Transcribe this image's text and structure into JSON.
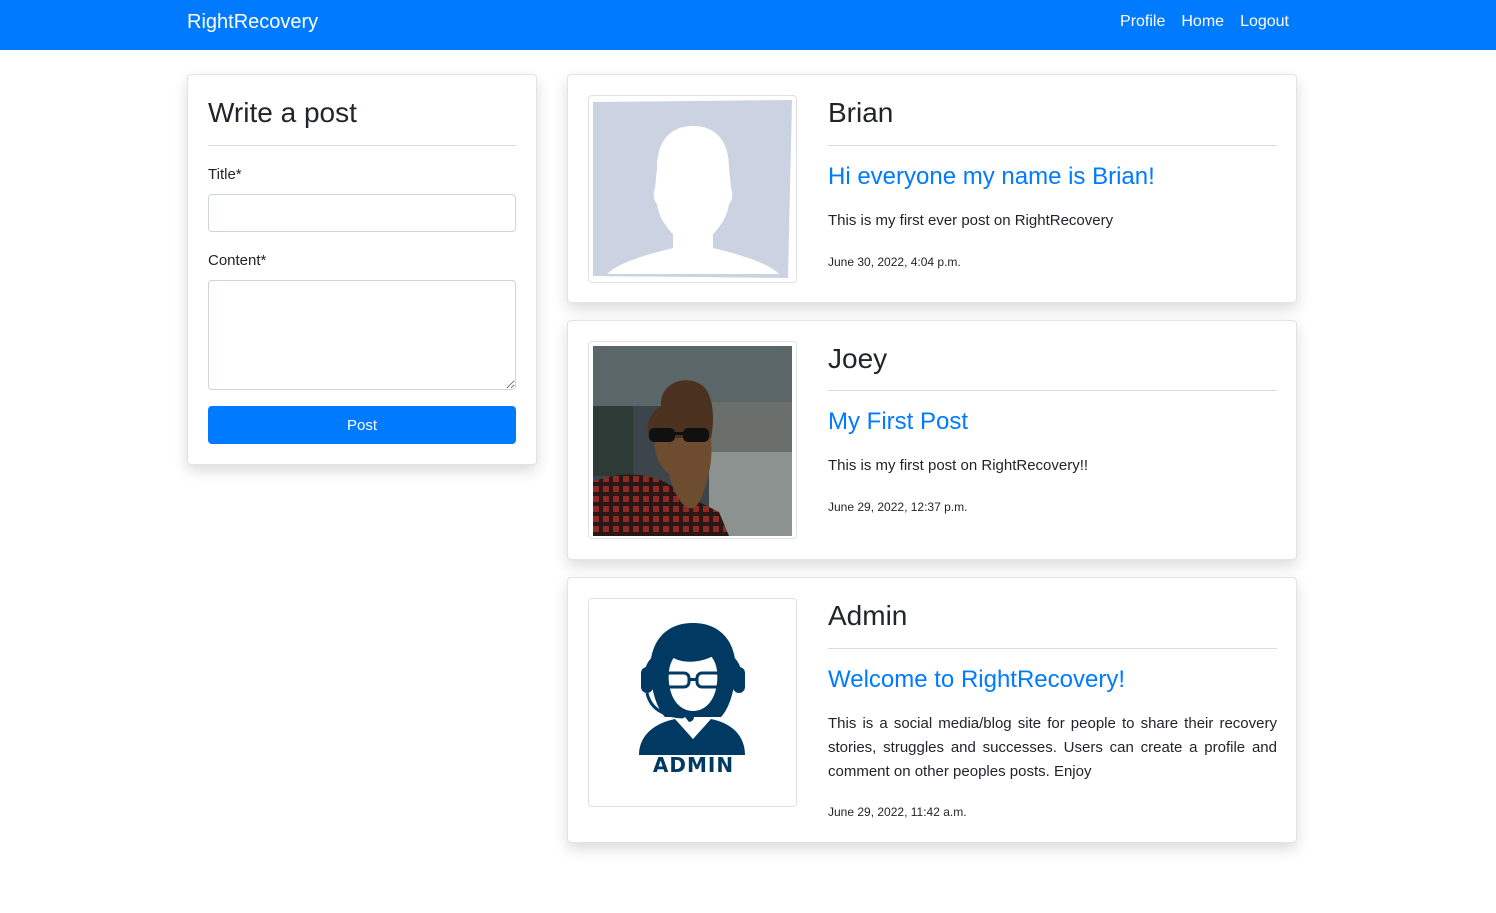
{
  "nav": {
    "brand": "RightRecovery",
    "links": [
      "Profile",
      "Home",
      "Logout"
    ]
  },
  "write_post": {
    "heading": "Write a post",
    "title_label": "Title*",
    "title_value": "",
    "content_label": "Content*",
    "content_value": "",
    "submit_label": "Post"
  },
  "posts": [
    {
      "author": "Brian",
      "title": "Hi everyone my name is Brian!",
      "content": "This is my first ever post on RightRecovery",
      "date": "June 30, 2022, 4:04 p.m.",
      "avatar": "default-silhouette-avatar"
    },
    {
      "author": "Joey",
      "title": "My First Post",
      "content": "This is my first post on RightRecovery!!",
      "date": "June 29, 2022, 12:37 p.m.",
      "avatar": "bearded-man-photo"
    },
    {
      "author": "Admin",
      "title": "Welcome to RightRecovery!",
      "content": "This is a social media/blog site for people to share their recovery stories, struggles and successes. Users can create a profile and comment on other peoples posts. Enjoy",
      "date": "June 29, 2022, 11:42 a.m.",
      "avatar": "admin-headset-avatar",
      "avatar_text": "ADMIN"
    }
  ],
  "colors": {
    "primary": "#007bff",
    "silhouette_bg": "#cbd2e1",
    "admin_navy": "#003a63"
  }
}
